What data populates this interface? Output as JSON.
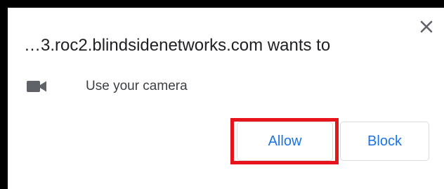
{
  "dialog": {
    "title": "…3.roc2.blindsidenetworks.com wants to",
    "permission": {
      "icon": "video-camera-icon",
      "label": "Use your camera"
    },
    "close_icon": "close-icon",
    "buttons": {
      "allow_label": "Allow",
      "block_label": "Block"
    },
    "highlight_color": "#e8141c",
    "accent_color": "#1a73e8"
  }
}
